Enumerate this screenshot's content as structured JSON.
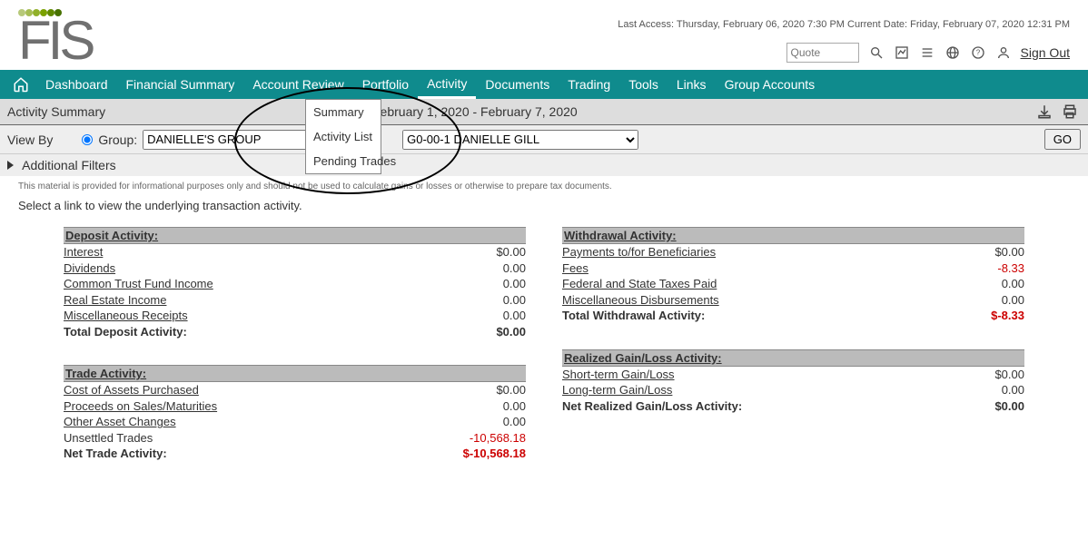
{
  "header": {
    "last_access_label": "Last Access:",
    "last_access_value": "Thursday, February 06, 2020 7:30 PM",
    "current_date_label": "Current Date:",
    "current_date_value": "Friday, February 07, 2020 12:31 PM",
    "quote_placeholder": "Quote",
    "signout": "Sign Out"
  },
  "nav": {
    "items": [
      "Dashboard",
      "Financial Summary",
      "Account Review",
      "Portfolio",
      "Activity",
      "Documents",
      "Trading",
      "Tools",
      "Links",
      "Group Accounts"
    ]
  },
  "activity_menu": {
    "items": [
      "Summary",
      "Activity List",
      "Pending Trades"
    ]
  },
  "subheader": {
    "title": "Activity Summary",
    "daterange": "February 1, 2020 - February 7, 2020"
  },
  "filter": {
    "viewby": "View By",
    "group_label": "Group:",
    "group_value": "DANIELLE'S GROUP",
    "account_value": "G0-00-1 DANIELLE GILL",
    "go": "GO",
    "additional_filters": "Additional Filters"
  },
  "disclaimer": "This material is provided for informational purposes only and should not be used to calculate gains or losses or otherwise to prepare tax documents.",
  "instruction": "Select a link to view the underlying transaction activity.",
  "deposit": {
    "title": "Deposit Activity:",
    "rows": [
      {
        "label": "Interest",
        "value": "$0.00"
      },
      {
        "label": "Dividends",
        "value": "0.00"
      },
      {
        "label": "Common Trust Fund Income",
        "value": "0.00"
      },
      {
        "label": "Real Estate Income",
        "value": "0.00"
      },
      {
        "label": "Miscellaneous Receipts",
        "value": "0.00"
      }
    ],
    "total_label": "Total Deposit Activity:",
    "total_value": "$0.00"
  },
  "trade": {
    "title": "Trade Activity:",
    "rows": [
      {
        "label": "Cost of Assets Purchased",
        "value": "$0.00"
      },
      {
        "label": "Proceeds on Sales/Maturities",
        "value": "0.00"
      },
      {
        "label": "Other Asset Changes",
        "value": "0.00"
      },
      {
        "label": "Unsettled Trades",
        "value": "-10,568.18",
        "neg": true
      }
    ],
    "total_label": "Net Trade Activity:",
    "total_value": "$-10,568.18",
    "total_neg": true
  },
  "withdrawal": {
    "title": "Withdrawal Activity:",
    "rows": [
      {
        "label": "Payments to/for Beneficiaries",
        "value": "$0.00"
      },
      {
        "label": "Fees",
        "value": "-8.33",
        "neg": true
      },
      {
        "label": "Federal and State Taxes Paid",
        "value": "0.00"
      },
      {
        "label": "Miscellaneous Disbursements",
        "value": "0.00"
      }
    ],
    "total_label": "Total Withdrawal Activity:",
    "total_value": "$-8.33",
    "total_neg": true
  },
  "gainloss": {
    "title": "Realized Gain/Loss Activity:",
    "rows": [
      {
        "label": "Short-term Gain/Loss",
        "value": "$0.00"
      },
      {
        "label": "Long-term Gain/Loss",
        "value": "0.00"
      }
    ],
    "total_label": "Net Realized Gain/Loss Activity:",
    "total_value": "$0.00"
  }
}
